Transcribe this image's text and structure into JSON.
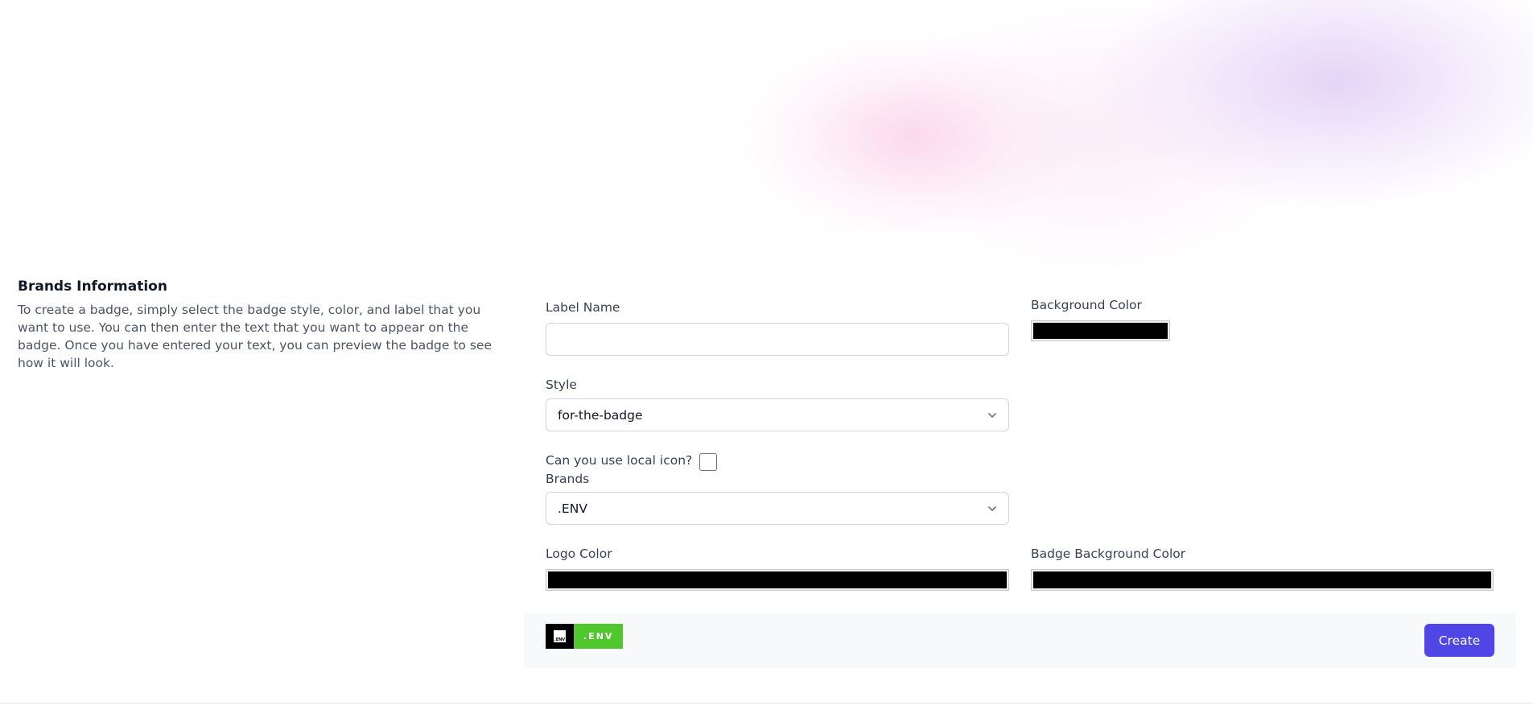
{
  "section": {
    "title": "Brands Information",
    "description": "To create a badge, simply select the badge style, color, and label that you want to use. You can then enter the text that you want to appear on the badge. Once you have entered your text, you can preview the badge to see how it will look."
  },
  "form": {
    "label_name": {
      "label": "Label Name",
      "value": ""
    },
    "background_color": {
      "label": "Background Color",
      "value": "#000000"
    },
    "style": {
      "label": "Style",
      "value": "for-the-badge"
    },
    "local_icon": {
      "label": "Can you use local icon?",
      "checked": false
    },
    "brands": {
      "label": "Brands",
      "value": ".ENV"
    },
    "logo_color": {
      "label": "Logo Color",
      "value": "#000000"
    },
    "badge_background_color": {
      "label": "Badge Background Color",
      "value": "#000000"
    }
  },
  "preview": {
    "badge_text": ".ENV",
    "badge_logo_text": ".ENV",
    "logo_bg": "#000000",
    "text_bg": "#4fc72d"
  },
  "actions": {
    "create_label": "Create"
  },
  "colors": {
    "accent": "#4f46e5"
  }
}
